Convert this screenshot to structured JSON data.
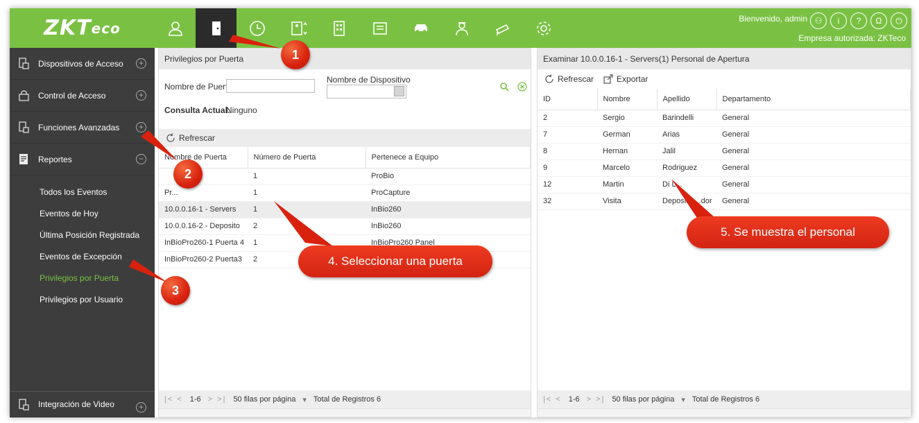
{
  "brand": {
    "logo_main": "ZKT",
    "logo_tail": "eco"
  },
  "header": {
    "welcome": "Bienvenido, admin",
    "company": "Empresa autorizada: ZKTeco",
    "modules": [
      "personnel-icon",
      "access-door-icon",
      "attendance-clock-icon",
      "elevator-icon",
      "visitor-building-icon",
      "parking-icon",
      "car-icon",
      "patrol-guard-icon",
      "video-camera-icon",
      "settings-gear-icon"
    ],
    "active_module": 1,
    "accent_color": "#7ac143"
  },
  "sidebar": {
    "groups": [
      {
        "label": "Dispositivos de Acceso"
      },
      {
        "label": "Control de Acceso"
      },
      {
        "label": "Funciones Avanzadas"
      },
      {
        "label": "Reportes"
      }
    ],
    "sub_items": [
      {
        "label": "Todos los Eventos"
      },
      {
        "label": "Eventos de Hoy"
      },
      {
        "label": "Última Posición Registrada"
      },
      {
        "label": "Eventos de Excepción"
      },
      {
        "label": "Privilegios por Puerta",
        "active": true
      },
      {
        "label": "Privilegios por Usuario"
      }
    ],
    "bottom": {
      "label": "Integración de Video"
    }
  },
  "left_panel": {
    "title": "Privilegios por Puerta",
    "door_name_label": "Nombre de Puerta",
    "door_name_value": "",
    "device_name_label": "Nombre de Dispositivo",
    "device_name_value": "",
    "current_query_label": "Consulta Actual:",
    "current_query_value": "Ninguno",
    "refresh_label": "Refrescar",
    "columns": [
      "Nombre de Puerta",
      "Número de Puerta",
      "Pertenece a Equipo"
    ],
    "rows": [
      [
        "",
        "1",
        "ProBio"
      ],
      [
        "Pr...",
        "1",
        "ProCapture"
      ],
      [
        "10.0.0.16-1 - Servers",
        "1",
        "InBio260"
      ],
      [
        "10.0.0.16-2 - Deposito",
        "2",
        "InBio260"
      ],
      [
        "InBioPro260-1 Puerta 4",
        "1",
        "InBioPro260 Panel"
      ],
      [
        "InBioPro260-2 Puerta3",
        "2",
        ""
      ]
    ],
    "selected_row": 2,
    "pager": {
      "range": "1-6",
      "per_page": "50 filas por página",
      "total": "Total de Registros 6"
    }
  },
  "right_panel": {
    "title": "Examinar 10.0.0.16-1 - Servers(1) Personal de Apertura",
    "refresh_label": "Refrescar",
    "export_label": "Exportar",
    "columns": [
      "ID",
      "Nombre",
      "Apellido",
      "Departamento"
    ],
    "rows": [
      [
        "2",
        "Sergio",
        "Barindelli",
        "General"
      ],
      [
        "7",
        "German",
        "Arias",
        "General"
      ],
      [
        "8",
        "Hernan",
        "Jalil",
        "General"
      ],
      [
        "9",
        "Marcelo",
        "Rodriguez",
        "General"
      ],
      [
        "12",
        "Martin",
        "Di L...",
        "General"
      ],
      [
        "32",
        "Visita",
        "Deposito ...dor",
        "General"
      ]
    ],
    "pager": {
      "range": "1-6",
      "per_page": "50 filas por página",
      "total": "Total de Registros 6"
    }
  },
  "callouts": {
    "c1": "1",
    "c2": "2",
    "c3": "3",
    "c4": "4. Seleccionar una puerta",
    "c5": "5. Se muestra el personal"
  }
}
